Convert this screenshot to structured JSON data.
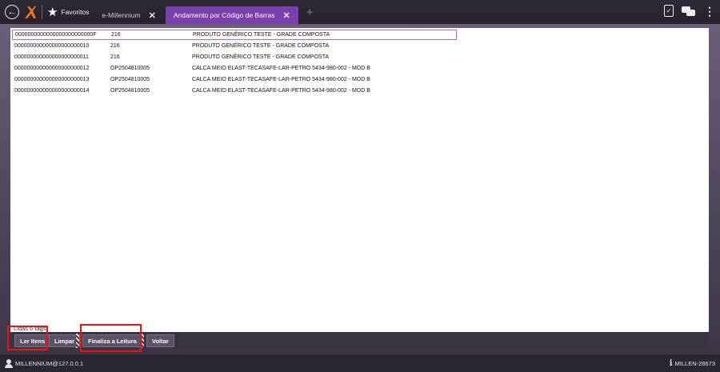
{
  "topbar": {
    "back_icon": "arrow-left-circle-icon",
    "logo_icon": "millennium-logo",
    "favorites_label": "Favoritos",
    "tabs": [
      {
        "label": "e-Millennium",
        "close": "✕"
      },
      {
        "label": "Andamento por Código de Barras",
        "close": "✕"
      }
    ],
    "new_tab": "+",
    "right_icons": [
      "clipboard-check-icon",
      "chat-icon",
      "more-vertical-icon"
    ]
  },
  "grid": {
    "rows": [
      {
        "code": "0000000000000000000000000F",
        "ref": "216",
        "desc": "PRODUTO GENÉRICO TESTE - GRADE COMPOSTA"
      },
      {
        "code": "000000000000000000000010",
        "ref": "216",
        "desc": "PRODUTO GENÉRICO TESTE - GRADE COMPOSTA"
      },
      {
        "code": "000000000000000000000011",
        "ref": "216",
        "desc": "PRODUTO GENÉRICO TESTE - GRADE COMPOSTA"
      },
      {
        "code": "000000000000000000000012",
        "ref": "OP2504810005",
        "desc": "CALCA MEIO ELAST-TECASAFE-LAR-PETRO 5434-980-002 - MOD B"
      },
      {
        "code": "000000000000000000000013",
        "ref": "OP2504810005",
        "desc": "CALCA MEIO ELAST-TECASAFE-LAR-PETRO 5434-980-002 - MOD B"
      },
      {
        "code": "000000000000000000000014",
        "ref": "OP2504810005",
        "desc": "CALCA MEIO ELAST-TECASAFE-LAR-PETRO 5434-980-002 - MOD B"
      }
    ]
  },
  "status_text": "Lidas 6 tags",
  "buttons": {
    "ler_itens": "Ler Itens",
    "limpar": "Limpar",
    "finaliza": "Finaliza a Leitura",
    "voltar": "Voltar"
  },
  "statusbar": {
    "user": "MILLENNIUM@127.0.0.1",
    "server": "MILLEN-28673"
  },
  "colors": {
    "active_tab": "#7b3fb0",
    "selection_border": "#b06ad6",
    "highlight": "#ee1111"
  }
}
